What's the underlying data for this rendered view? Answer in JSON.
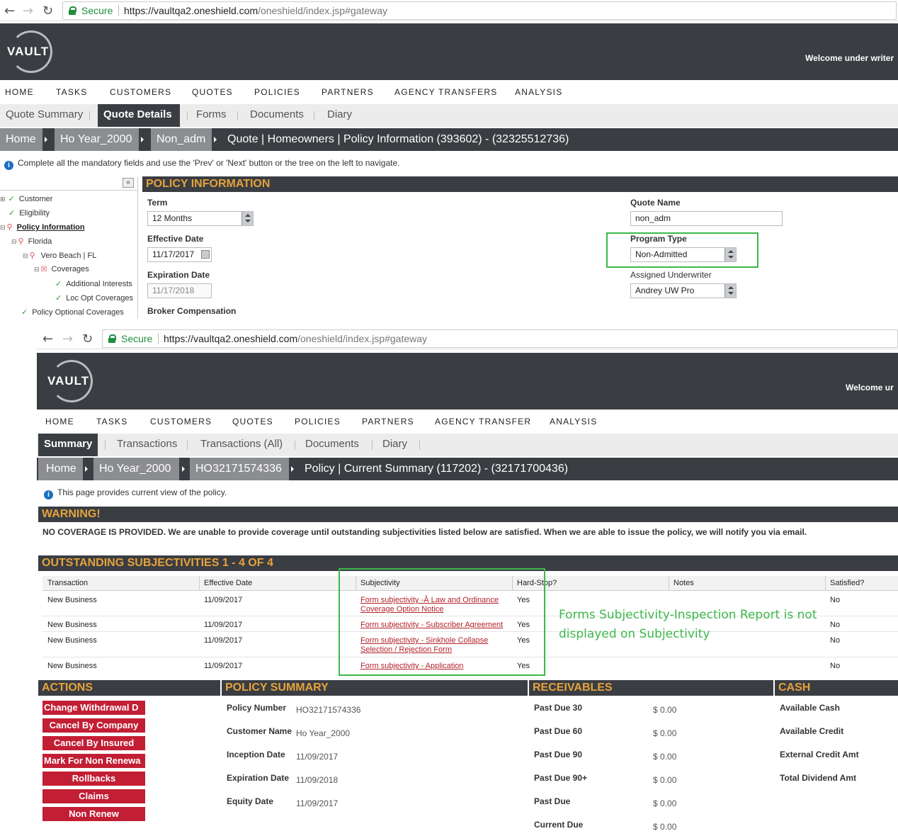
{
  "top": {
    "browser": {
      "secure": "Secure",
      "url_host": "https://vaultqa2.oneshield.com",
      "url_path": "/oneshield/index.jsp#gateway"
    },
    "logo": "VAULT",
    "welcome": "Welcome   under writer",
    "nav": [
      "HOME",
      "TASKS",
      "CUSTOMERS",
      "QUOTES",
      "POLICIES",
      "PARTNERS",
      "AGENCY TRANSFERS",
      "ANALYSIS"
    ],
    "tabs": [
      "Quote Summary",
      "Quote Details",
      "Forms",
      "Documents",
      "Diary"
    ],
    "active_tab": "Quote Details",
    "breadcrumbs": [
      "Home",
      "Ho Year_2000",
      "Non_adm"
    ],
    "breadcrumb_title": "Quote | Homeowners | Policy Information (393602) - (32325512736)",
    "info": "Complete all the mandatory fields and use the 'Prev' or 'Next' button or the tree on the left to navigate.",
    "tree": [
      "Customer",
      "Eligibility",
      "Policy Information",
      "Florida",
      "Vero Beach | FL",
      "Coverages",
      "Additional Interests",
      "Loc Opt Coverages",
      "Policy Optional Coverages"
    ],
    "section_title": "POLICY INFORMATION",
    "form": {
      "term_label": "Term",
      "term_value": "12 Months",
      "effective_label": "Effective Date",
      "effective_value": "11/17/2017",
      "expiration_label": "Expiration Date",
      "expiration_value": "11/17/2018",
      "broker_label": "Broker Compensation",
      "quote_name_label": "Quote Name",
      "quote_name_value": "non_adm",
      "program_type_label": "Program Type",
      "program_type_value": "Non-Admitted",
      "underwriter_label": "Assigned Underwriter",
      "underwriter_value": "Andrey UW  Pro"
    }
  },
  "bottom": {
    "browser": {
      "secure": "Secure",
      "url_host": "https://vaultqa2.oneshield.com",
      "url_path": "/oneshield/index.jsp#gateway"
    },
    "logo": "VAULT",
    "welcome": "Welcome   ur",
    "nav": [
      "HOME",
      "TASKS",
      "CUSTOMERS",
      "QUOTES",
      "POLICIES",
      "PARTNERS",
      "AGENCY TRANSFER",
      "ANALYSIS"
    ],
    "tabs": [
      "Summary",
      "Transactions",
      "Transactions (All)",
      "Documents",
      "Diary"
    ],
    "active_tab": "Summary",
    "breadcrumbs": [
      "Home",
      "Ho Year_2000",
      "HO32171574336"
    ],
    "breadcrumb_title": "Policy | Current Summary (117202) - (32171700436)",
    "info": "This page provides current view of the policy.",
    "warning_title": "WARNING!",
    "warning_text": "NO COVERAGE IS PROVIDED. We are unable to provide coverage until outstanding subjectivities listed below are satisfied. When we are able to issue the policy, we will notify you via email.",
    "subj_title": "OUTSTANDING SUBJECTIVITIES 1 - 4 OF 4",
    "subj_columns": [
      "Transaction",
      "Effective Date",
      "Subjectivity",
      "Hard-Stop?",
      "Notes",
      "Satisfied?"
    ],
    "subj_rows": [
      {
        "transaction": "New Business",
        "effective": "11/09/2017",
        "subjectivity": "Form subjectivity -Â Law and Ordinance Coverage Option Notice",
        "hard_stop": "Yes",
        "notes": "",
        "satisfied": "No"
      },
      {
        "transaction": "New Business",
        "effective": "11/09/2017",
        "subjectivity": "Form subjectivity - Subscriber Agreement",
        "hard_stop": "Yes",
        "notes": "",
        "satisfied": "No"
      },
      {
        "transaction": "New Business",
        "effective": "11/09/2017",
        "subjectivity": "Form subjectivity - Sinkhole Collapse Selection / Rejection Form",
        "hard_stop": "Yes",
        "notes": "",
        "satisfied": "No"
      },
      {
        "transaction": "New Business",
        "effective": "11/09/2017",
        "subjectivity": "Form subjectivity - Application",
        "hard_stop": "Yes",
        "notes": "",
        "satisfied": "No"
      }
    ],
    "annotation": "Forms Subjectivity-Inspection Report is not displayed on Subjectivity",
    "actions_title": "ACTIONS",
    "actions": [
      "Change Withdrawal D",
      "Cancel By Company",
      "Cancel By Insured",
      "Mark For Non Renewa",
      "Rollbacks",
      "Claims",
      "Non Renew"
    ],
    "summary_title": "POLICY SUMMARY",
    "summary": [
      {
        "label": "Policy Number",
        "value": "HO32171574336"
      },
      {
        "label": "Customer Name",
        "value": "Ho Year_2000"
      },
      {
        "label": "Inception Date",
        "value": "11/09/2017"
      },
      {
        "label": "Expiration Date",
        "value": "11/09/2018"
      },
      {
        "label": "Equity Date",
        "value": "11/09/2017"
      }
    ],
    "receivables_title": "RECEIVABLES",
    "receivables": [
      {
        "label": "Past Due 30",
        "value": "$ 0.00"
      },
      {
        "label": "Past Due 60",
        "value": "$ 0.00"
      },
      {
        "label": "Past Due 90",
        "value": "$ 0.00"
      },
      {
        "label": "Past Due 90+",
        "value": "$ 0.00"
      },
      {
        "label": "Past Due",
        "value": "$ 0.00"
      },
      {
        "label": "Current Due",
        "value": "$ 0.00"
      }
    ],
    "cash_title": "CASH",
    "cash": [
      "Available Cash",
      "Available Credit",
      "External Credit Amt",
      "Total Dividend Amt"
    ]
  },
  "colors": {
    "header": "#3a3d42",
    "section_title": "#e6a23c",
    "action_button": "#c21e34",
    "annotation": "#3cb84a",
    "link": "#b3232b"
  }
}
